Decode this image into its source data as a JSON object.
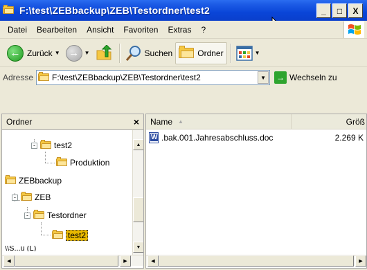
{
  "window": {
    "title": "F:\\test\\ZEBbackup\\ZEB\\Testordner\\test2",
    "minimize": "_",
    "maximize": "□",
    "close": "X"
  },
  "menu": [
    "Datei",
    "Bearbeiten",
    "Ansicht",
    "Favoriten",
    "Extras",
    "?"
  ],
  "toolbar": {
    "back_label": "Zurück",
    "search_label": "Suchen",
    "folders_label": "Ordner"
  },
  "address": {
    "label": "Adresse",
    "value": "F:\\test\\ZEBbackup\\ZEB\\Testordner\\test2",
    "go_label": "Wechseln zu"
  },
  "folder_pane": {
    "title": "Ordner",
    "close": "×",
    "items": [
      {
        "label": "test2",
        "expander": "-"
      },
      {
        "label": "Produktion"
      },
      {
        "label": "ZEBbackup"
      },
      {
        "label": "ZEB",
        "expander": "-"
      },
      {
        "label": "Testordner",
        "expander": "-"
      },
      {
        "label": "test2",
        "selected": true
      },
      {
        "label": "\\\\S...u (L)"
      }
    ]
  },
  "file_list": {
    "columns": {
      "name": "Name",
      "size": "Größ"
    },
    "files": [
      {
        "name": ".bak.001.Jahresabschluss.doc",
        "size": "2.269 K"
      }
    ]
  },
  "colors": {
    "titlebar": "#0a45d8",
    "selected_folder": "#e8b800",
    "chrome": "#ece9d8"
  }
}
